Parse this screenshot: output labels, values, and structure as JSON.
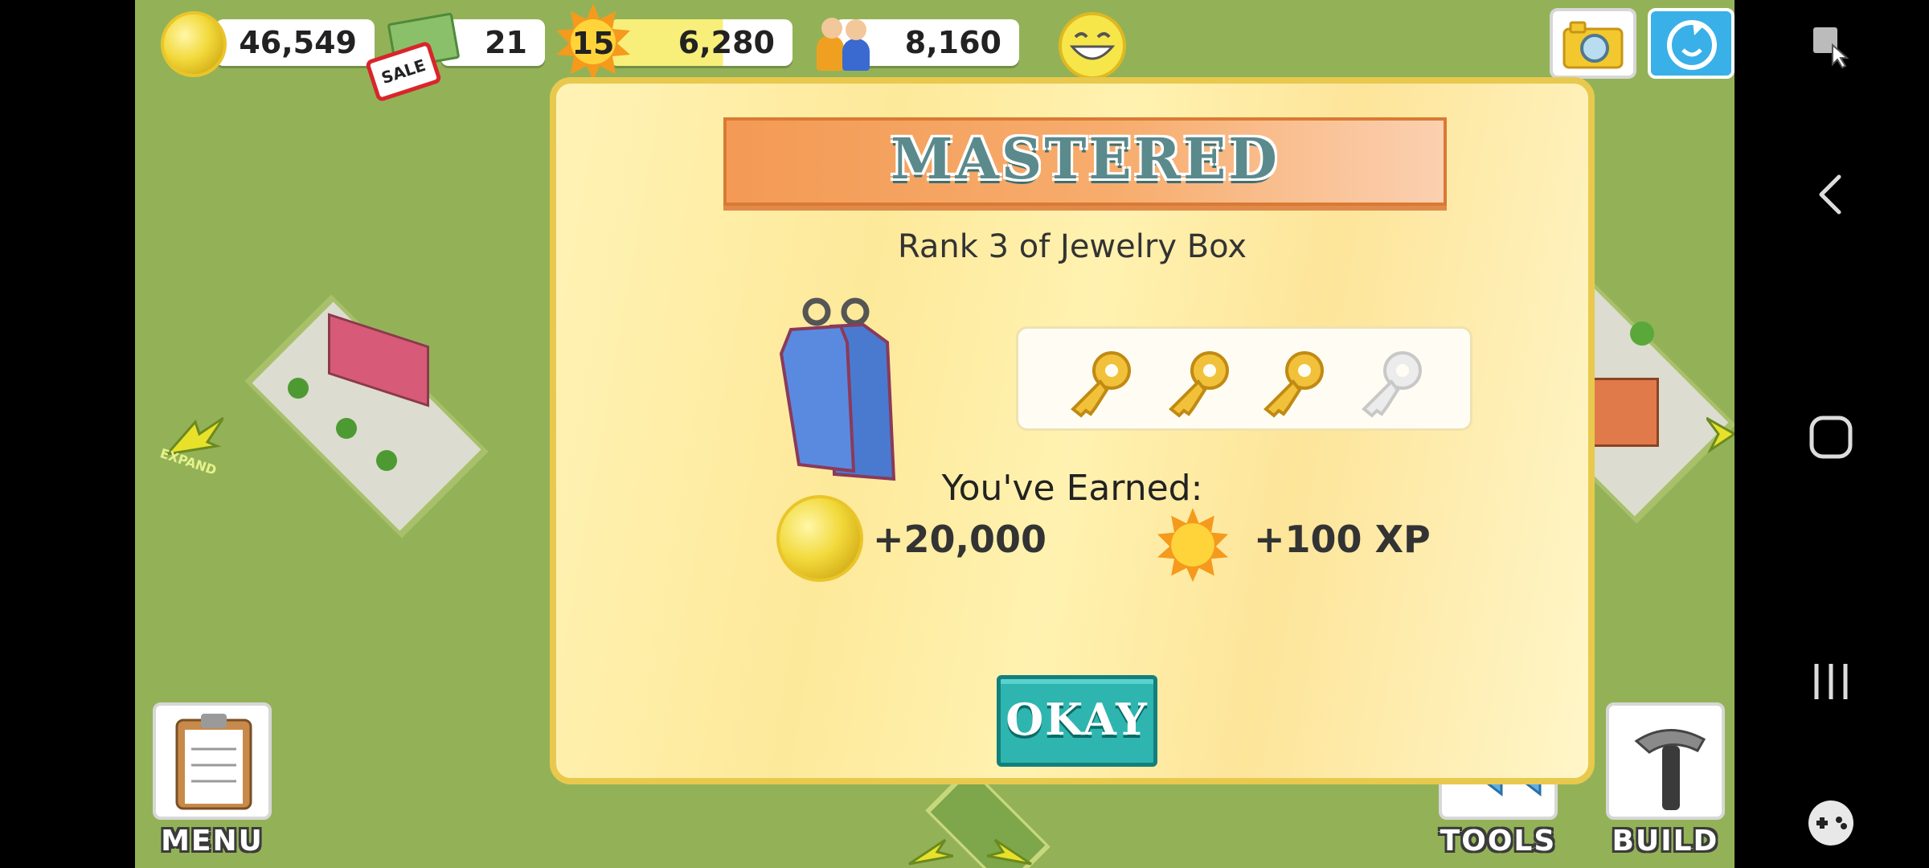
{
  "hud": {
    "coins": "46,549",
    "cash": "21",
    "sale_label": "SALE",
    "level": "15",
    "xp": "6,280",
    "population": "8,160"
  },
  "world": {
    "expand_label": "EXPAND"
  },
  "dialog": {
    "title": "MASTERED",
    "rank_text": "Rank 3 of Jewelry Box",
    "keys_earned": 3,
    "keys_total": 4,
    "earned_label": "You've Earned:",
    "coin_reward": "+20,000",
    "xp_reward": "+100 XP",
    "okay_label": "OKAY"
  },
  "bottom": {
    "menu_label": "MENU",
    "tools_label": "TOOLS",
    "build_label": "BUILD"
  },
  "colors": {
    "grass": "#93b258",
    "dialog_border": "#e8c94e",
    "banner": "#f39a55",
    "okay": "#2fb5b0",
    "gold_key": "#f2c13a",
    "silver_key": "#e6e6e6"
  },
  "icons": [
    "camera-icon",
    "share-icon",
    "back-icon",
    "home-icon",
    "recents-icon",
    "game-controller-icon"
  ]
}
